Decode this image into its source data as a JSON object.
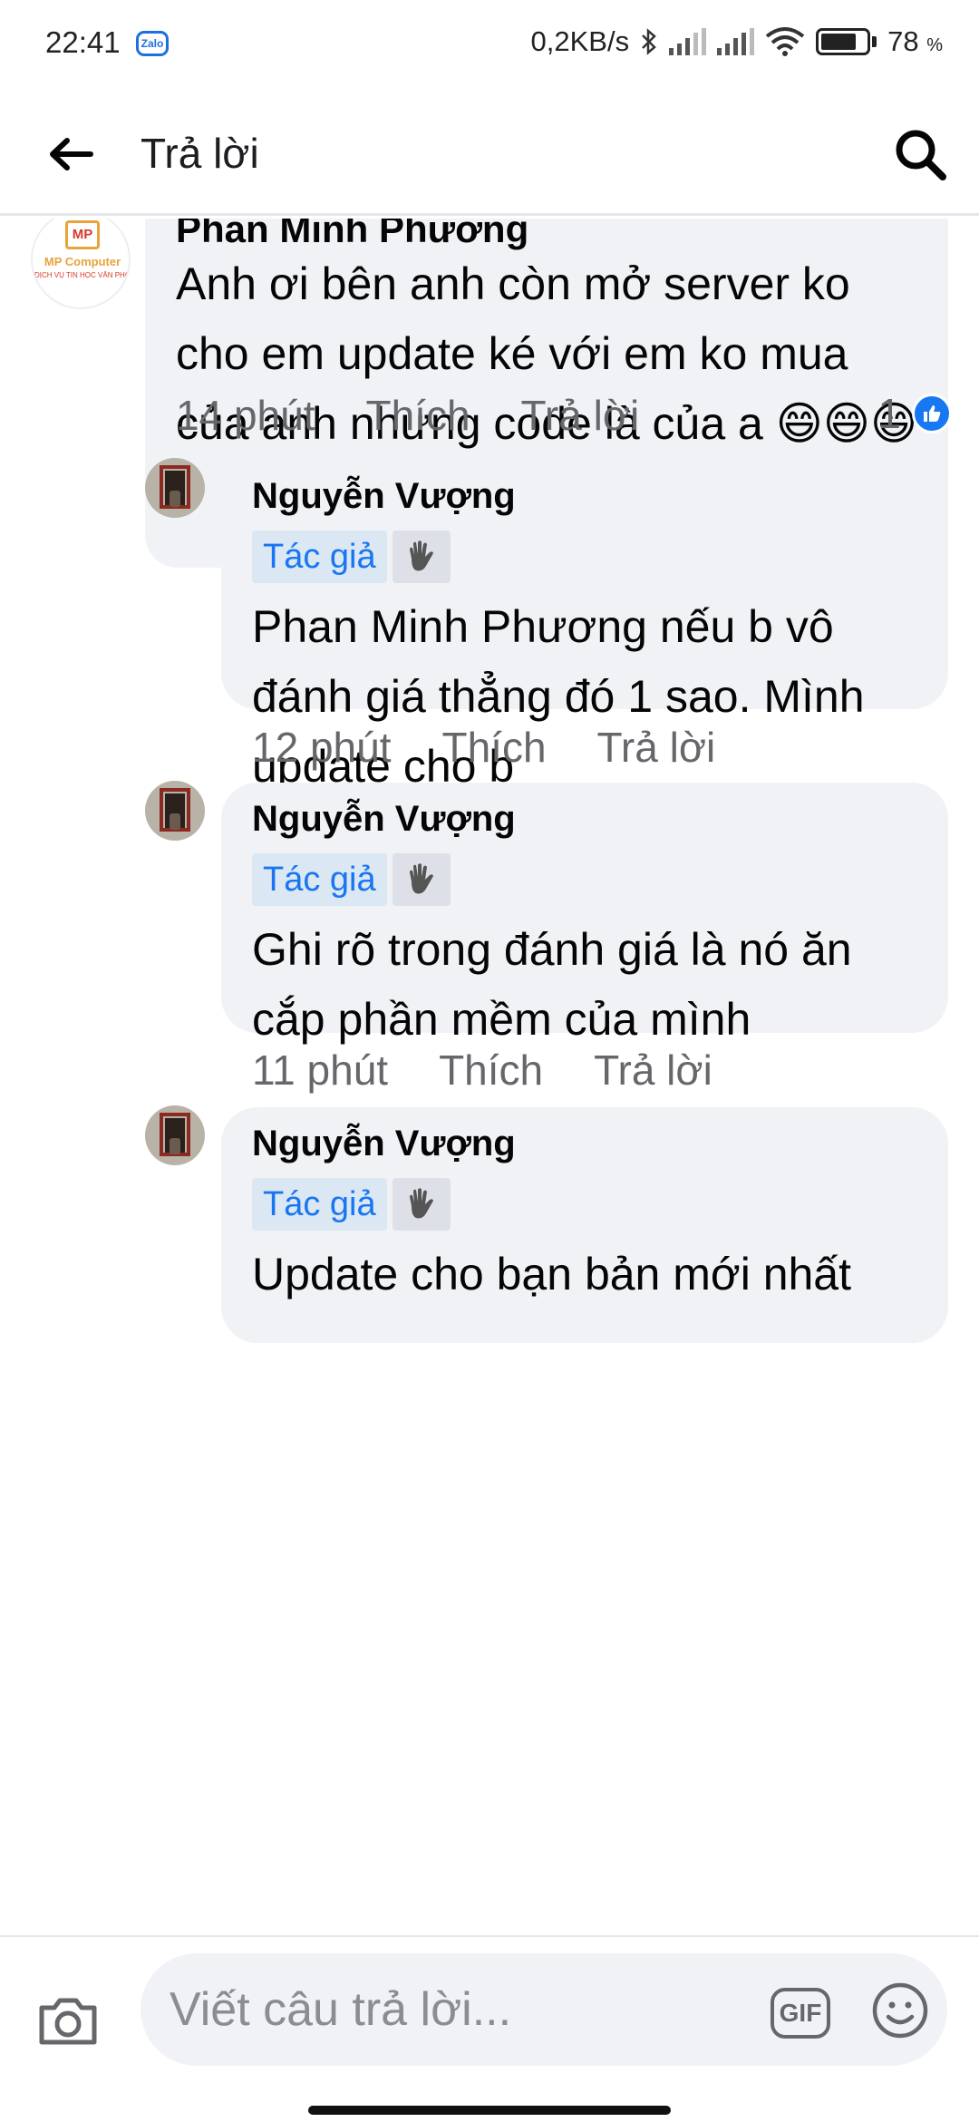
{
  "status_bar": {
    "time": "22:41",
    "zalo_label": "Zalo",
    "network_speed": "0,2KB/s",
    "battery_percent": "78",
    "battery_unit": "%",
    "battery_level": 0.78
  },
  "header": {
    "back_icon": "arrow-left-icon",
    "title": "Trả lời",
    "search_icon": "search-icon"
  },
  "comment": {
    "author": "Phan Minh Phương",
    "avatar_logo": "MP",
    "avatar_brand": "MP Computer",
    "avatar_tagline": "DỊCH VỤ TIN HỌC VĂN PHÒ",
    "text": "Anh ơi bên anh còn mở server ko cho em update ké với em ko mua của anh nhưng code là của a 😄😄😄",
    "time": "14 phút",
    "like_label": "Thích",
    "reply_label": "Trả lời",
    "reaction_count": "1",
    "reaction_icon": "like-icon"
  },
  "replies": [
    {
      "author": "Nguyễn Vượng",
      "badge": "Tác giả",
      "mention": "Phan Minh Phương",
      "text": " nếu b vô đánh giá thẳng đó 1 sao. Mình update cho b",
      "time": "12 phút",
      "like_label": "Thích",
      "reply_label": "Trả lời"
    },
    {
      "author": "Nguyễn Vượng",
      "badge": "Tác giả",
      "text": "Ghi rõ trong đánh giá là nó ăn cắp phần mềm của mình",
      "time": "11 phút",
      "like_label": "Thích",
      "reply_label": "Trả lời"
    },
    {
      "author": "Nguyễn Vượng",
      "badge": "Tác giả",
      "text": "Update cho bạn bản mới nhất"
    }
  ],
  "composer": {
    "camera_icon": "camera-icon",
    "placeholder": "Viết câu trả lời...",
    "gif_label": "GIF",
    "emoji_icon": "smiley-icon"
  },
  "colors": {
    "accent": "#1876f2",
    "bubble": "#f0f2f5",
    "meta_text": "#65676b"
  }
}
